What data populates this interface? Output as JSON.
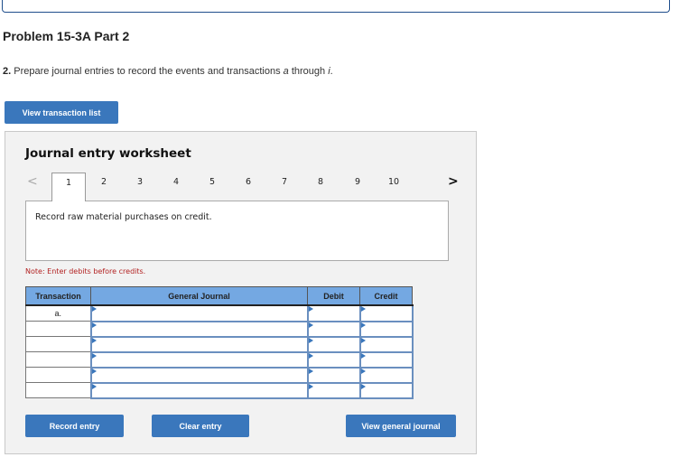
{
  "header": {
    "problem_title": "Problem 15-3A Part 2",
    "instruction_number": "2.",
    "instruction_text_1": " Prepare journal entries to record the events and transactions ",
    "instruction_italic_1": "a",
    "instruction_text_2": " through ",
    "instruction_italic_2": "i",
    "instruction_text_3": "."
  },
  "buttons": {
    "view_transaction_list": "View transaction list",
    "record_entry": "Record entry",
    "clear_entry": "Clear entry",
    "view_general_journal": "View general journal"
  },
  "worksheet": {
    "title": "Journal entry worksheet",
    "prev_arrow": "<",
    "next_arrow": ">",
    "tabs": [
      "1",
      "2",
      "3",
      "4",
      "5",
      "6",
      "7",
      "8",
      "9",
      "10"
    ],
    "active_tab": "1",
    "description": "Record raw material purchases on credit.",
    "note": "Note: Enter debits before credits."
  },
  "journal": {
    "headers": {
      "transaction": "Transaction",
      "general_journal": "General Journal",
      "debit": "Debit",
      "credit": "Credit"
    },
    "rows": [
      {
        "transaction": "a.",
        "account": "",
        "debit": "",
        "credit": ""
      },
      {
        "transaction": "",
        "account": "",
        "debit": "",
        "credit": ""
      },
      {
        "transaction": "",
        "account": "",
        "debit": "",
        "credit": ""
      },
      {
        "transaction": "",
        "account": "",
        "debit": "",
        "credit": ""
      },
      {
        "transaction": "",
        "account": "",
        "debit": "",
        "credit": ""
      },
      {
        "transaction": "",
        "account": "",
        "debit": "",
        "credit": ""
      }
    ]
  },
  "colors": {
    "button_blue": "#3a77bc",
    "header_blue": "#74a8e2",
    "note_red": "#b22222",
    "panel_bg": "#f2f2f2"
  }
}
